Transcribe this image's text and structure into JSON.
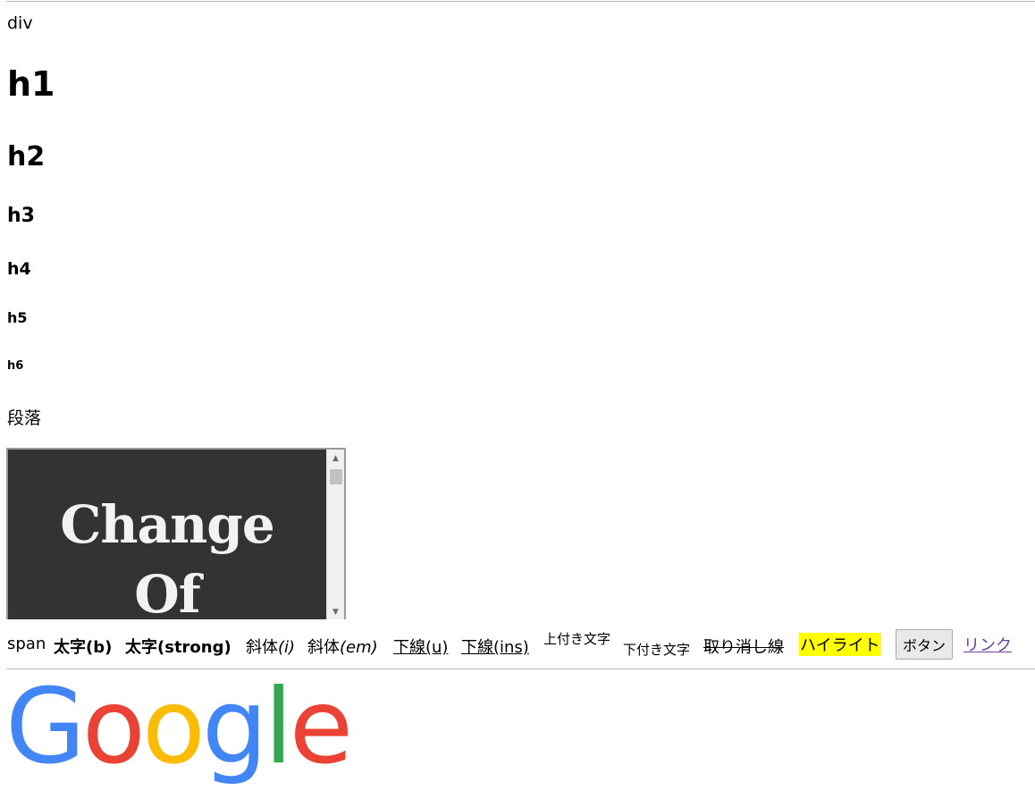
{
  "div_text": "div",
  "headings": {
    "h1": "h1",
    "h2": "h2",
    "h3": "h3",
    "h4": "h4",
    "h5": "h5",
    "h6": "h6"
  },
  "paragraph": "段落",
  "iframe": {
    "line1": "Change",
    "line2": "Of"
  },
  "inline": {
    "span": "span",
    "bold_b": "太字(b)",
    "bold_strong": "太字(strong)",
    "italic_i_prefix": "斜体",
    "italic_i": "(i)",
    "italic_em_prefix": "斜体",
    "italic_em": "(em)",
    "underline_u": "下線(u)",
    "underline_ins": "下線(ins)",
    "superscript": "上付き文字",
    "subscript": "下付き文字",
    "strikethrough": "取り消し線",
    "highlight": "ハイライト",
    "button": "ボタン",
    "link": "リンク"
  },
  "logo": {
    "letters": [
      "G",
      "o",
      "o",
      "g",
      "l",
      "e"
    ],
    "colors": [
      "#4285F4",
      "#EA4335",
      "#FBBC05",
      "#4285F4",
      "#34A853",
      "#EA4335"
    ]
  },
  "colors": {
    "highlight": "#ffff00",
    "link": "#6b3fa0",
    "iframe_bg": "#333333"
  }
}
